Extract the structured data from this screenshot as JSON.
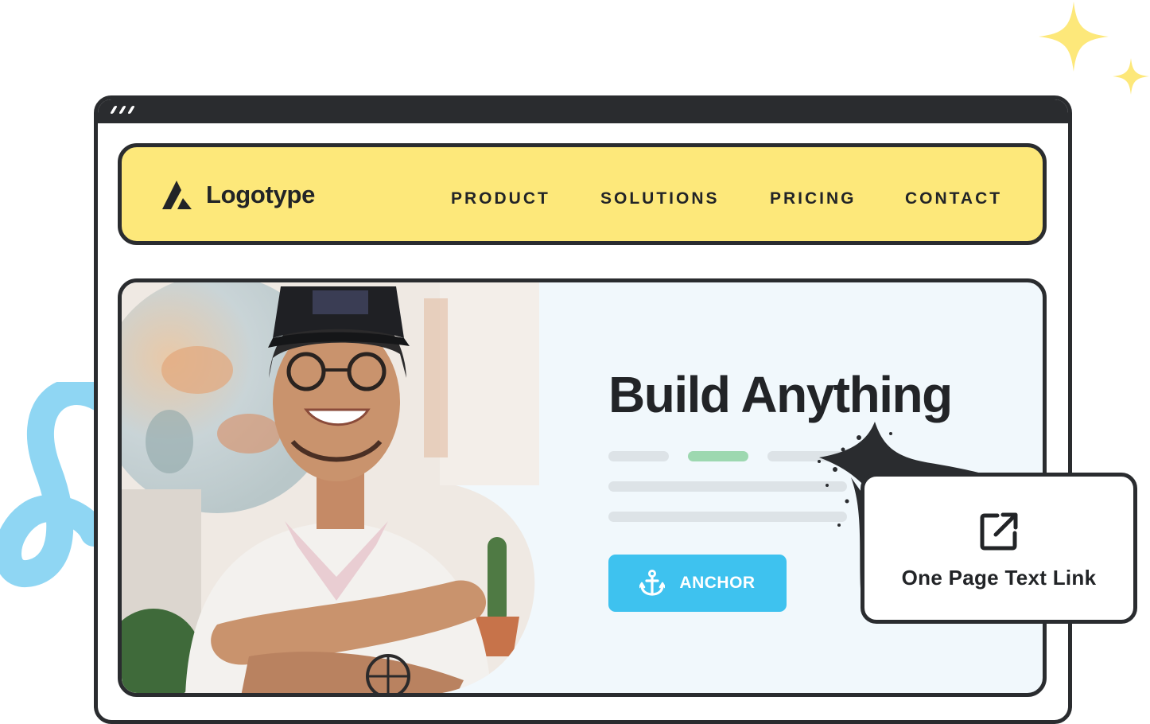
{
  "nav": {
    "logo_text": "Logotype",
    "links": [
      "PRODUCT",
      "SOLUTIONS",
      "PRICING",
      "CONTACT"
    ]
  },
  "hero": {
    "headline": "Build Anything",
    "button_label": "ANCHOR",
    "button_icon": "anchor-icon"
  },
  "tooltip": {
    "label": "One Page Text Link",
    "icon": "external-link-icon"
  },
  "colors": {
    "nav_background": "#fde87a",
    "button": "#3ec2ef",
    "hero_background": "#f1f8fc",
    "accent_bar": "#9dd8b0",
    "outline": "#2a2c2f",
    "sparkle": "#fde87a",
    "swirl": "#8fd6f3"
  }
}
